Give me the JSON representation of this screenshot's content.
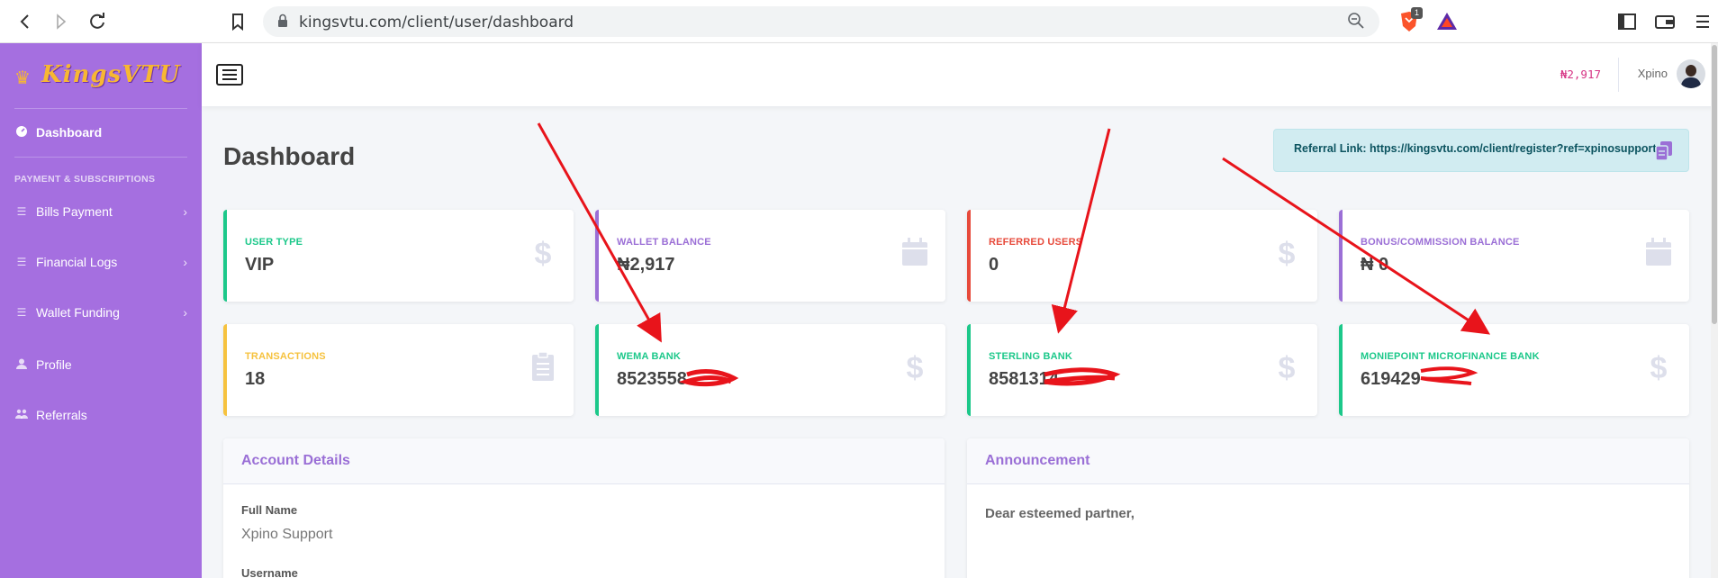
{
  "browser": {
    "url": "kingsvtu.com/client/user/dashboard",
    "brave_badge": "1"
  },
  "sidebar": {
    "brand": "KingsVTU",
    "items": [
      {
        "label": "Dashboard",
        "icon": "tachometer-icon"
      },
      {
        "label": "Bills Payment",
        "icon": "list-icon"
      },
      {
        "label": "Financial Logs",
        "icon": "list-icon"
      },
      {
        "label": "Wallet Funding",
        "icon": "list-icon"
      },
      {
        "label": "Profile",
        "icon": "user-icon"
      },
      {
        "label": "Referrals",
        "icon": "users-icon"
      }
    ],
    "heading": "PAYMENT & SUBSCRIPTIONS"
  },
  "topbar": {
    "balance": "₦2,917",
    "username": "Xpino"
  },
  "page": {
    "title": "Dashboard",
    "referral_text": "Referral Link: https://kingsvtu.com/client/register?ref=xpinosupport"
  },
  "cards": [
    {
      "label": "USER TYPE",
      "value": "VIP",
      "color": "#1cc88a",
      "icon": "dollar-icon"
    },
    {
      "label": "WALLET BALANCE",
      "value": "₦2,917",
      "color": "#9b6fd6",
      "icon": "calendar-icon"
    },
    {
      "label": "REFERRED USERS",
      "value": "0",
      "color": "#e74a3b",
      "icon": "dollar-icon"
    },
    {
      "label": "BONUS/COMMISSION BALANCE",
      "value": "₦ 0",
      "color": "#9b6fd6",
      "icon": "calendar-icon"
    },
    {
      "label": "TRANSACTIONS",
      "value": "18",
      "color": "#f6c23e",
      "icon": "clipboard-icon"
    },
    {
      "label": "WEMA BANK",
      "value": "8523558",
      "color": "#1cc88a",
      "icon": "dollar-icon"
    },
    {
      "label": "STERLING BANK",
      "value": "8581314",
      "color": "#1cc88a",
      "icon": "dollar-icon"
    },
    {
      "label": "MONIEPOINT MICROFINANCE BANK",
      "value": "619429",
      "color": "#1cc88a",
      "icon": "dollar-icon"
    }
  ],
  "account_details": {
    "title": "Account Details",
    "full_name_label": "Full Name",
    "full_name": "Xpino Support",
    "username_label": "Username"
  },
  "announcement": {
    "title": "Announcement",
    "text": "Dear esteemed partner,"
  },
  "colors": {
    "sidebar": "#a56fe0",
    "accent_green": "#1cc88a",
    "accent_purple": "#9b6fd6",
    "annotation_red": "#e8141b"
  }
}
